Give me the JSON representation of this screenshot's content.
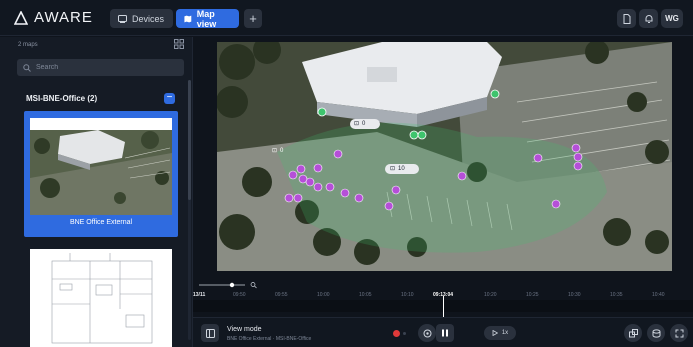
{
  "header": {
    "brand": "AWARE",
    "tabs": [
      {
        "label": "Devices",
        "icon": "devices-icon",
        "active": false
      },
      {
        "label": "Map view",
        "icon": "map-icon",
        "active": true
      }
    ],
    "add_label": "+",
    "user_initials": "WG",
    "icons": [
      "document-icon",
      "bell-icon"
    ]
  },
  "sidebar": {
    "maps_count": "2 maps",
    "search_placeholder": "Search",
    "group": {
      "title": "MSI-BNE-Office (2)",
      "toggle": "−"
    },
    "maps": [
      {
        "label": "BNE Office External",
        "selected": true
      },
      {
        "label": "",
        "selected": false
      }
    ]
  },
  "map": {
    "device_badges": [
      {
        "count": "0"
      },
      {
        "count": "0"
      },
      {
        "count": "10"
      }
    ],
    "accent_purple": "#b54fd8",
    "accent_green": "#3ec46d"
  },
  "timeline": {
    "date": "13/11",
    "ticks": [
      "09:50",
      "09:55",
      "10:00",
      "10:05",
      "10:10",
      "09:13:04",
      "10:20",
      "10:25",
      "10:30",
      "10:35",
      "10:40"
    ],
    "current_index": 5
  },
  "bottom": {
    "mode_title": "View mode",
    "mode_subtitle": "BNE Office External · MSI-BNE-Office",
    "speed": "1x"
  },
  "colors": {
    "accent": "#2f6be0",
    "background": "#0f141c",
    "panel": "#151b25"
  }
}
